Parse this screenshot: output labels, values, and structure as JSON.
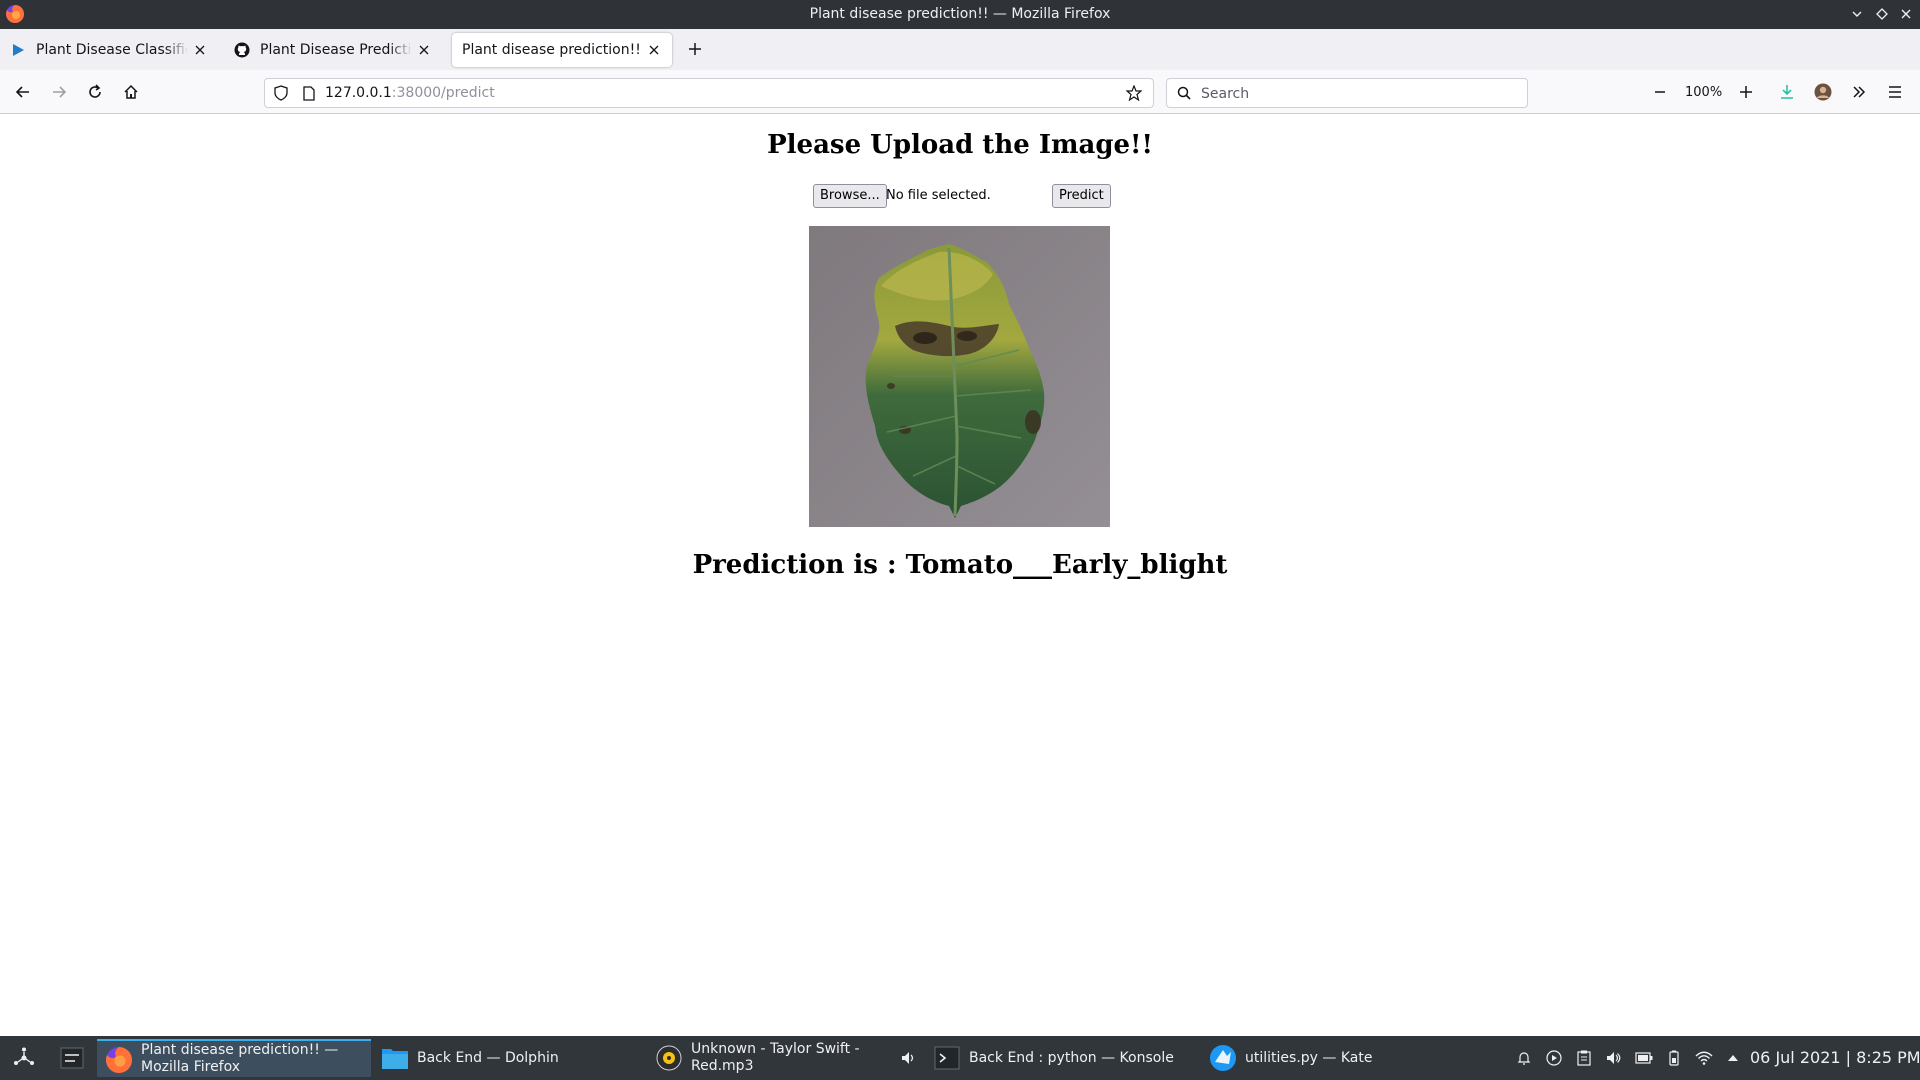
{
  "window": {
    "title": "Plant disease prediction!! — Mozilla Firefox"
  },
  "tabs": [
    {
      "title": "Plant Disease Classification",
      "icon": "play-icon"
    },
    {
      "title": "Plant Disease Prediction · Plant",
      "icon": "github-icon"
    },
    {
      "title": "Plant disease prediction!!",
      "icon": "none",
      "active": true
    }
  ],
  "navbar": {
    "url_host": "127.0.0.1",
    "url_path": ":38000/predict",
    "search_placeholder": "Search",
    "zoom": "100%"
  },
  "page": {
    "heading": "Please Upload the Image!!",
    "browse_label": "Browse...",
    "file_status": "No file selected.",
    "predict_label": "Predict",
    "prediction": "Prediction is : Tomato___Early_blight"
  },
  "taskbar": {
    "tasks": [
      {
        "label": "Plant disease prediction!! — Mozilla Firefox",
        "icon": "firefox-icon",
        "active": true
      },
      {
        "label": "Back End — Dolphin",
        "icon": "folder-icon"
      },
      {
        "label": "Unknown - Taylor Swift - Red.mp3",
        "icon": "music-player-icon"
      },
      {
        "label": "Back End : python — Konsole",
        "icon": "terminal-icon"
      },
      {
        "label": "utilities.py — Kate",
        "icon": "kate-editor-icon"
      }
    ],
    "clock": "06 Jul 2021 | 8:25 PM"
  },
  "colors": {
    "titlebar": "#2f3338",
    "taskbar": "#31363b",
    "taskbar_active": "#3d4f5f",
    "accent": "#3daee9",
    "download_green": "#2ac3a2"
  }
}
